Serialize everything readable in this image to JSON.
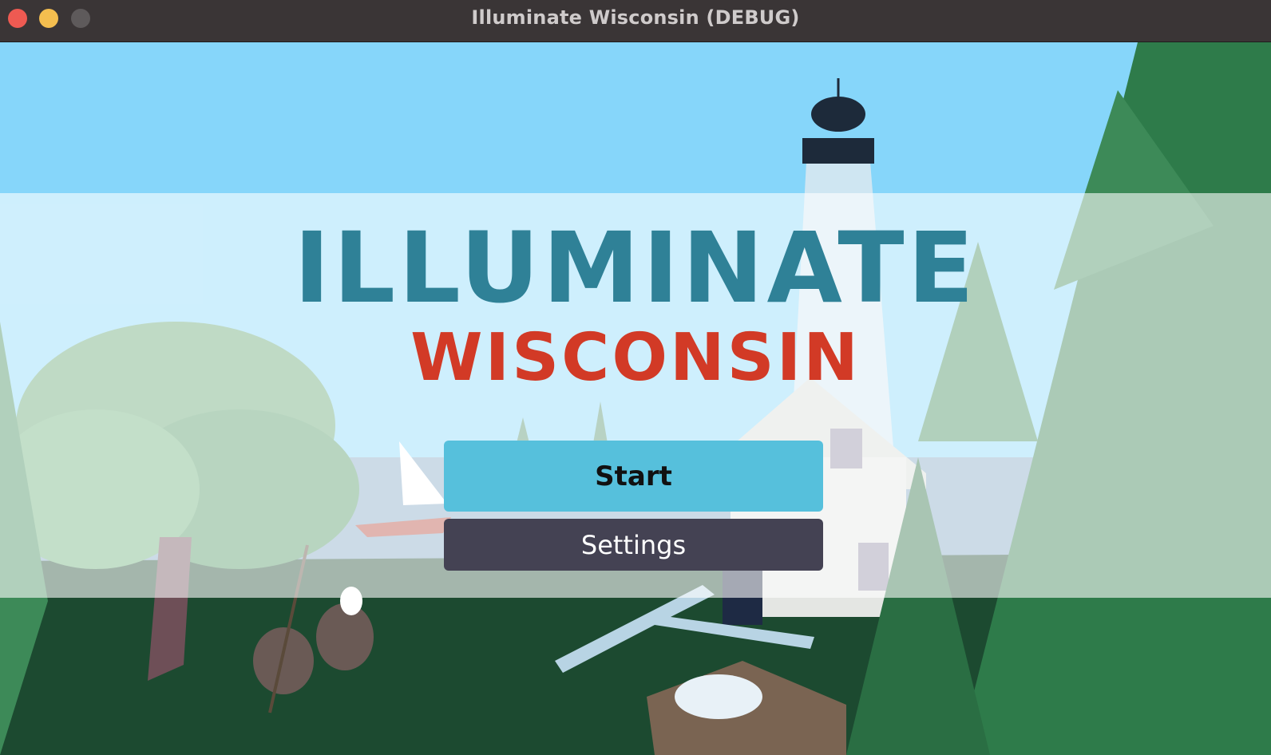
{
  "window": {
    "title": "Illuminate Wisconsin (DEBUG)"
  },
  "logo": {
    "title": "ILLUMINATE",
    "subtitle": "WISCONSIN"
  },
  "menu": {
    "start_label": "Start",
    "settings_label": "Settings"
  },
  "colors": {
    "sky": "#86d6fa",
    "title_teal": "#2f8197",
    "subtitle_red": "#d23a26",
    "start_button": "#56c0dc",
    "settings_button": "#444253",
    "titlebar": "#3a3536"
  }
}
